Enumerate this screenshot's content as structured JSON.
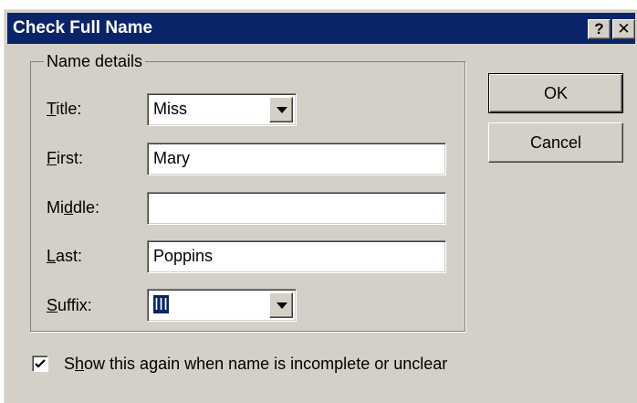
{
  "window": {
    "title": "Check Full Name",
    "help_glyph": "?",
    "close_glyph": "✕"
  },
  "group": {
    "label": "Name details",
    "fields": {
      "title": {
        "label_key": "T",
        "label_rest": "itle:",
        "value": "Miss"
      },
      "first": {
        "label_key": "F",
        "label_rest": "irst:",
        "value": "Mary"
      },
      "middle": {
        "label_pre": "Mi",
        "label_key": "d",
        "label_rest": "dle:",
        "value": ""
      },
      "last": {
        "label_key": "L",
        "label_rest": "ast:",
        "value": "Poppins"
      },
      "suffix": {
        "label_key": "S",
        "label_rest": "uffix:",
        "value": "III"
      }
    }
  },
  "buttons": {
    "ok": "OK",
    "cancel": "Cancel"
  },
  "option": {
    "checked": true,
    "label_pre": "S",
    "label_key": "h",
    "label_rest": "ow this again when name is incomplete or unclear"
  },
  "icons": {
    "dropdown": "chevron-down-icon",
    "check": "checkmark-icon"
  }
}
